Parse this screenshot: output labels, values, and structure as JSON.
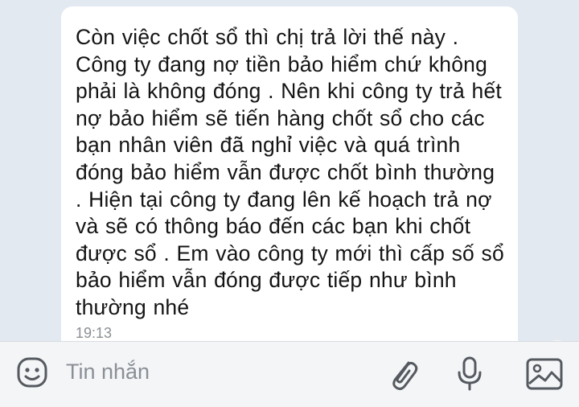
{
  "conversation": {
    "message": {
      "text": "Còn việc chốt sổ thì chị trả lời thế này . Công ty đang nợ tiền bảo hiểm chứ không phải là không đóng . Nên khi công ty trả hết nợ bảo hiểm sẽ tiến hàng chốt sổ cho các bạn nhân viên đã nghỉ việc và quá trình đóng bảo hiểm vẫn được chốt bình thường . Hiện tại công ty đang lên kế hoạch trả nợ và sẽ có thông báo đến các bạn khi chốt được sổ . Em vào công ty mới thì cấp số sổ bảo hiểm vẫn đóng được tiếp như bình thường nhé",
      "time": "19:13"
    }
  },
  "composer": {
    "placeholder": "Tin nhắn",
    "icons": {
      "emoji": "emoji-icon",
      "attach": "paperclip-icon",
      "mic": "microphone-icon",
      "image": "image-icon"
    }
  },
  "colors": {
    "chat_background": "#e2e9f1",
    "bubble": "#ffffff",
    "text": "#141414",
    "muted": "#8b8f94",
    "input_bar": "#f4f5f7"
  }
}
